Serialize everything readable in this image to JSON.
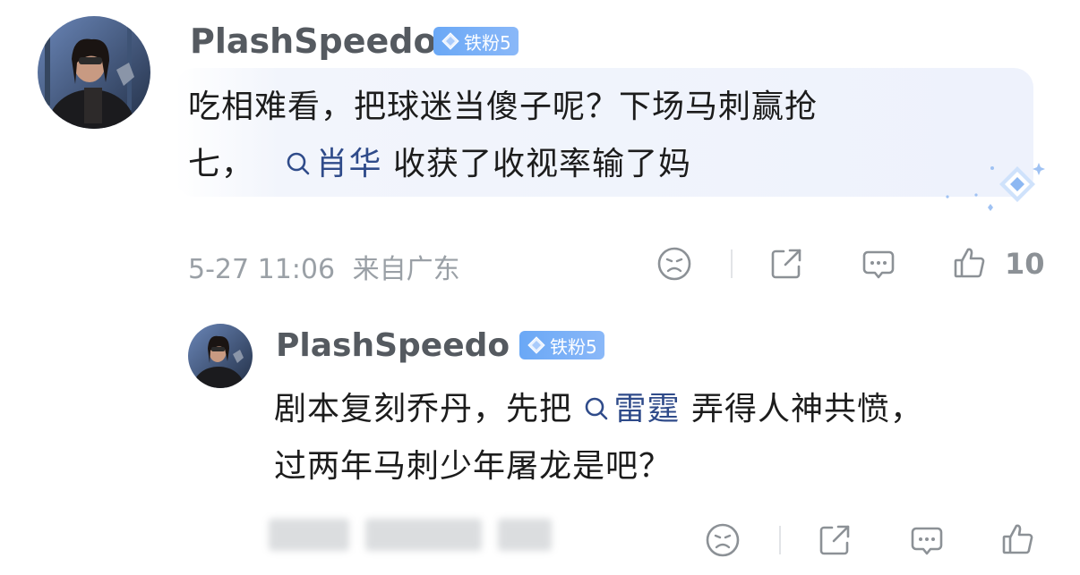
{
  "comment": {
    "username": "PlashSpeedo",
    "badge": "铁粉5",
    "text_line1": "吃相难看，把球迷当傻子呢？下场马刺赢抢",
    "text_line2_prefix": "七，",
    "mention": "肖华",
    "text_line2_suffix": "收获了收视率输了妈",
    "timestamp": "5-27 11:06",
    "location": "来自广东",
    "like_count": "10"
  },
  "reply": {
    "username": "PlashSpeedo",
    "badge": "铁粉5",
    "text_line1_prefix": "剧本复刻乔丹，先把",
    "mention": "雷霆",
    "text_line1_suffix": "弄得人神共愤，",
    "text_line2": "过两年马刺少年屠龙是吧？"
  },
  "icons": {
    "dislike": "sad-face-icon",
    "share": "share-icon",
    "reply": "comment-icon",
    "like": "thumbs-up-icon"
  },
  "colors": {
    "badge": "#6aa8f6",
    "mention": "#2f4b8a",
    "meta": "#9aa0a6"
  }
}
